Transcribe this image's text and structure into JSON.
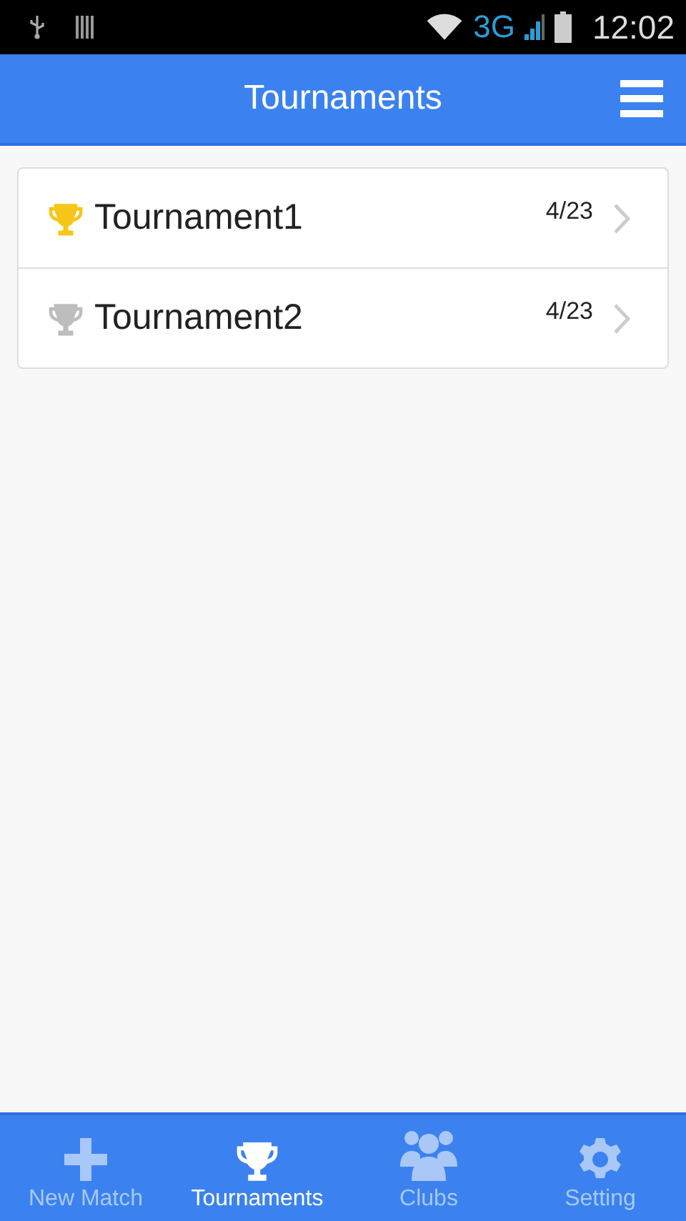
{
  "status_bar": {
    "network": "3G",
    "time": "12:02"
  },
  "header": {
    "title": "Tournaments"
  },
  "tournaments": [
    {
      "name": "Tournament1",
      "date": "4/23",
      "color": "#f5c518"
    },
    {
      "name": "Tournament2",
      "date": "4/23",
      "color": "#bdbdbd"
    }
  ],
  "tabs": [
    {
      "label": "New Match",
      "kind": "plus",
      "selected": false
    },
    {
      "label": "Tournaments",
      "kind": "trophy",
      "selected": true
    },
    {
      "label": "Clubs",
      "kind": "people",
      "selected": false
    },
    {
      "label": "Setting",
      "kind": "gear",
      "selected": false
    }
  ]
}
